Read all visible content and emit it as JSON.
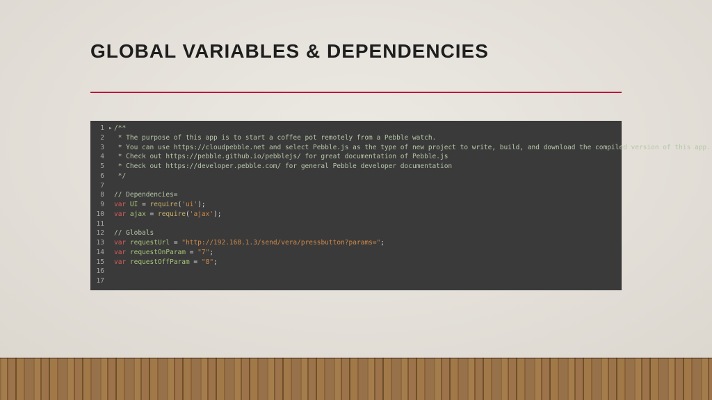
{
  "title": "GLOBAL VARIABLES & DEPENDENCIES",
  "code": {
    "line1": "/**",
    "line2": " * The purpose of this app is to start a coffee pot remotely from a Pebble watch.",
    "line3": " * You can use https://cloudpebble.net and select Pebble.js as the type of new project to write, build, and download the compiled version of this app.",
    "line4": " * Check out https://pebble.github.io/pebblejs/ for great documentation of Pebble.js",
    "line5": " * Check out https://developer.pebble.com/ for general Pebble developer documentation",
    "line6": " */",
    "line8c": "// Dependencies=",
    "var": "var",
    "requireFn": "require",
    "uiName": "UI",
    "uiArg": "'ui'",
    "ajaxName": "ajax",
    "ajaxArg": "'ajax'",
    "line12c": "// Globals",
    "reqUrlName": "requestUrl",
    "reqUrlVal": "\"http://192.168.1.3/send/vera/pressbutton?params=\"",
    "reqOnName": "requestOnParam",
    "reqOnVal": "\"7\"",
    "reqOffName": "requestOffParam",
    "reqOffVal": "\"8\""
  }
}
